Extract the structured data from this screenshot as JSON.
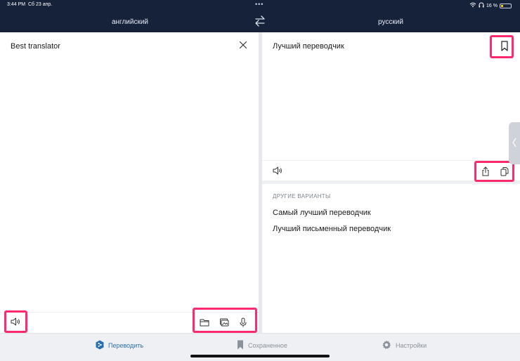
{
  "status_bar": {
    "time": "3:44 PM",
    "date": "Сб 23 апр.",
    "dots": "•••",
    "battery": "16 %"
  },
  "languages": {
    "source": "английский",
    "target": "русский"
  },
  "source_panel": {
    "text": "Best translator"
  },
  "translation_panel": {
    "text": "Лучший переводчик"
  },
  "alternatives": {
    "heading": "ДРУГИЕ ВАРИАНТЫ",
    "items": [
      "Самый лучший переводчик",
      "Лучший письменный переводчик"
    ]
  },
  "tabs": [
    {
      "label": "Переводить",
      "icon": "deepl-logo-icon",
      "active": true
    },
    {
      "label": "Сохраненное",
      "icon": "bookmark-icon",
      "active": false
    },
    {
      "label": "Настройки",
      "icon": "gear-icon",
      "active": false
    }
  ],
  "colors": {
    "header": "#15223a",
    "highlight": "#ff2a6d",
    "active_tab": "#2a6fb0",
    "battery_low": "#f5d300"
  }
}
